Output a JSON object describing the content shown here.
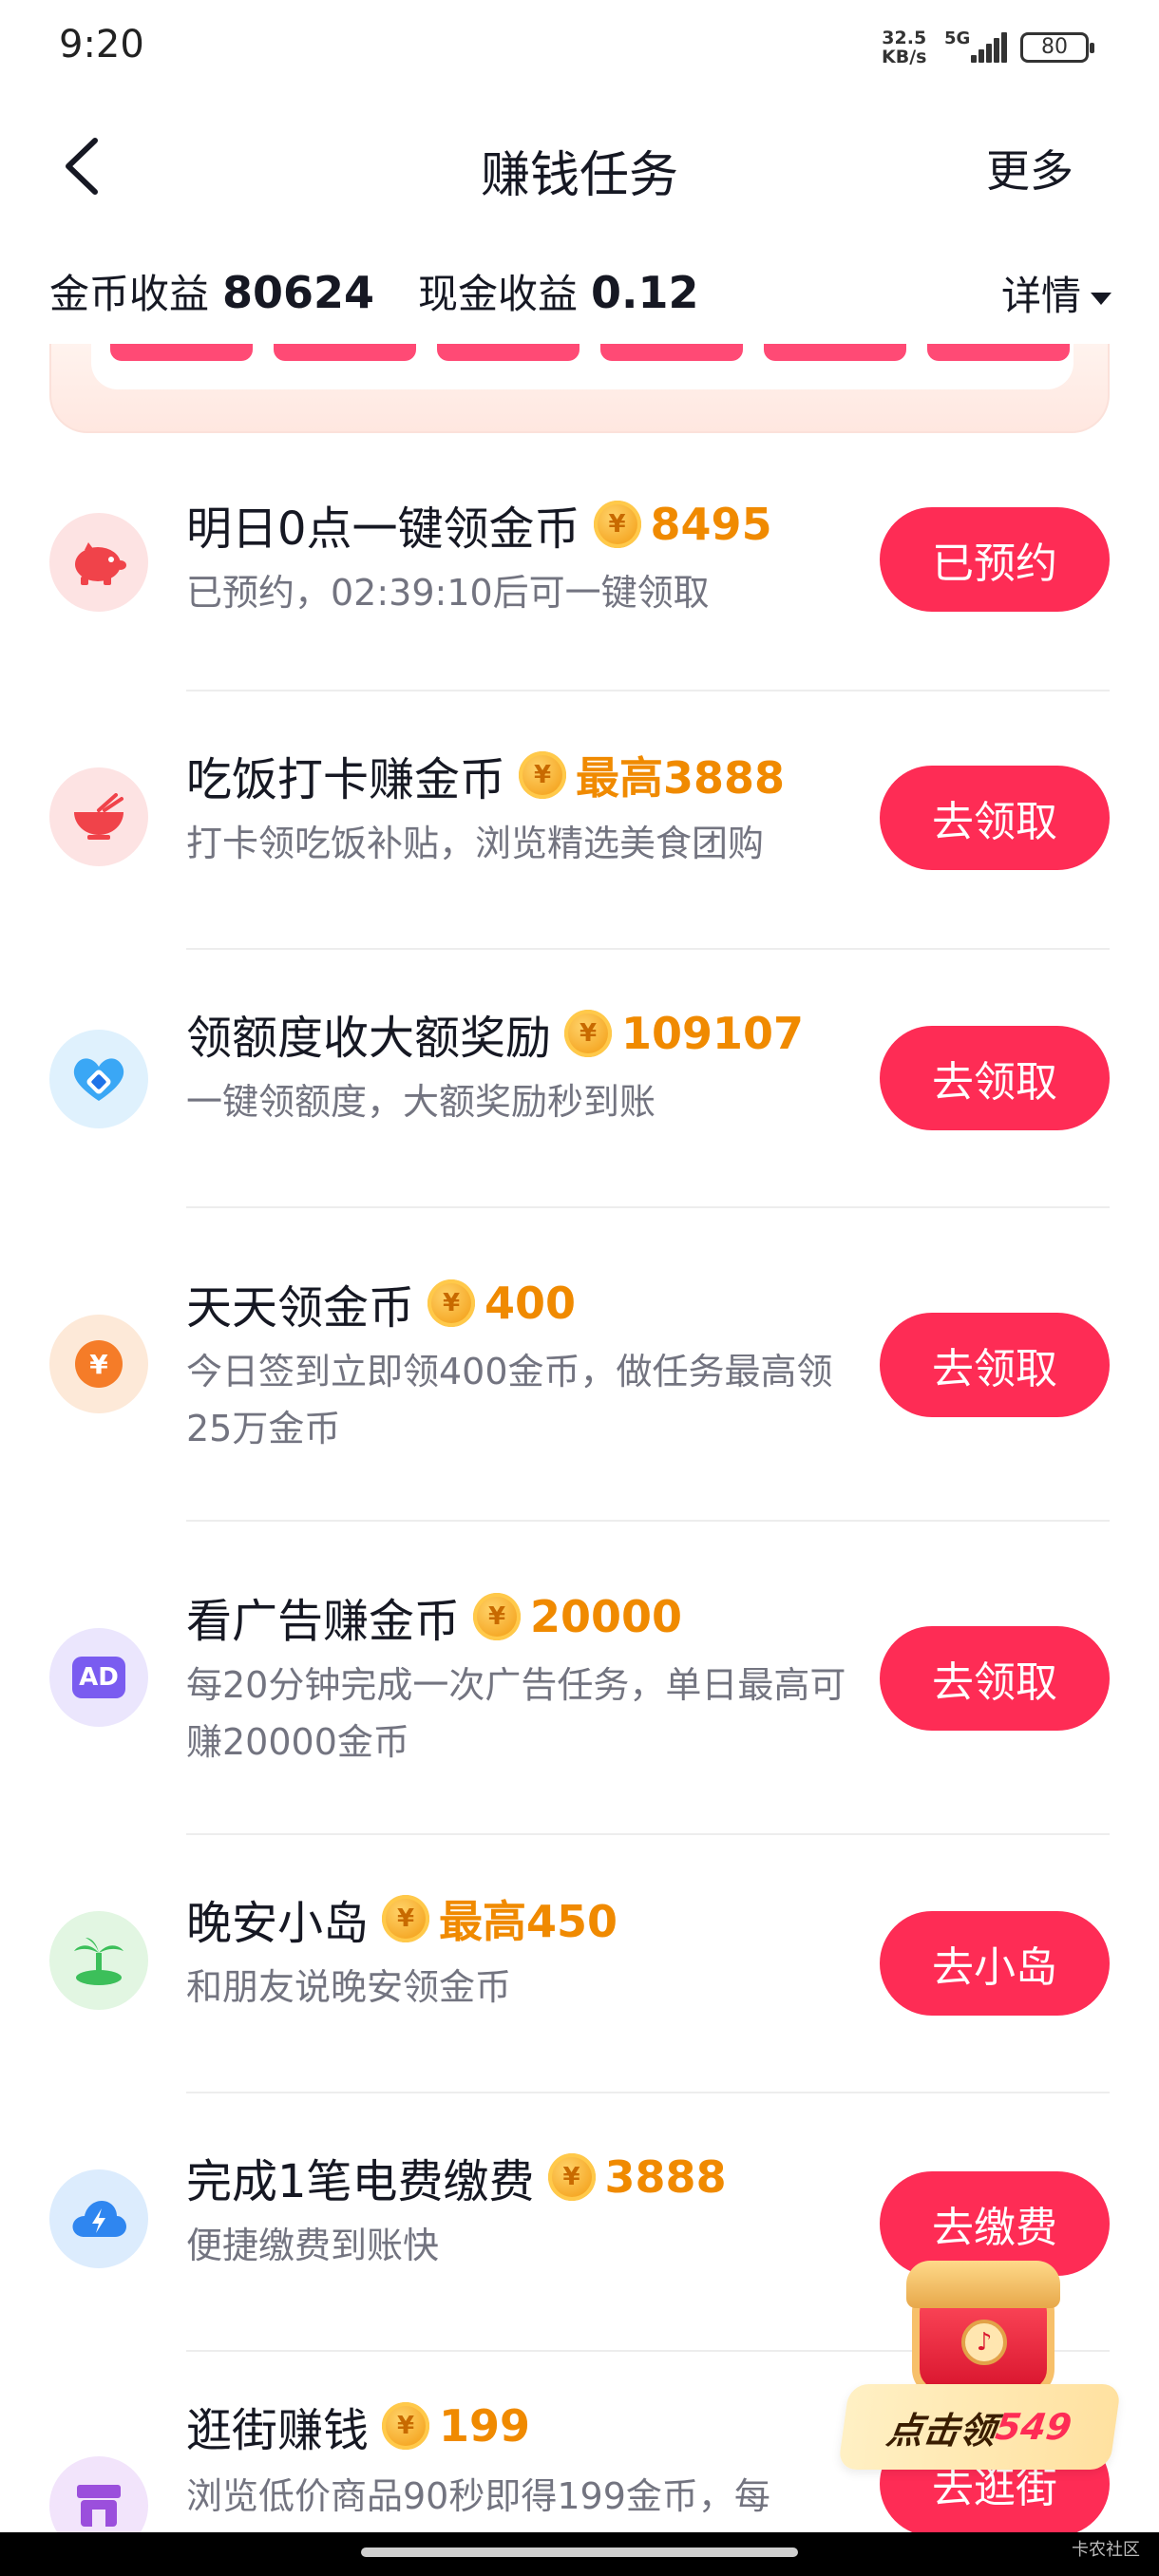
{
  "status_bar": {
    "time": "9:20",
    "net_speed_top": "32.5",
    "net_speed_bottom": "KB/s",
    "net_type": "5G",
    "battery": "80"
  },
  "nav": {
    "title": "赚钱任务",
    "more": "更多"
  },
  "earnings": {
    "gold_label": "金币收益",
    "gold_value": "80624",
    "cash_label": "现金收益",
    "cash_value": "0.12",
    "details": "详情"
  },
  "coin_symbol": "¥",
  "tasks": [
    {
      "title": "明日0点一键领金币",
      "reward": "8495",
      "desc": "已预约，02:39:10后可一键领取",
      "button": "已预约",
      "icon": "piggy-bank-icon"
    },
    {
      "title": "吃饭打卡赚金币",
      "reward": "最高3888",
      "desc": "打卡领吃饭补贴，浏览精选美食团购",
      "button": "去领取",
      "icon": "rice-bowl-icon"
    },
    {
      "title": "领额度收大额奖励",
      "reward": "109107",
      "desc": "一键领额度，大额奖励秒到账",
      "button": "去领取",
      "icon": "credit-heart-icon"
    },
    {
      "title": "天天领金币",
      "reward": "400",
      "desc": "今日签到立即领400金币，做任务最高领25万金币",
      "button": "去领取",
      "icon": "yuan-coin-icon"
    },
    {
      "title": "看广告赚金币",
      "reward": "20000",
      "desc": "每20分钟完成一次广告任务，单日最高可赚20000金币",
      "button": "去领取",
      "icon": "ad-icon",
      "icon_text": "AD"
    },
    {
      "title": "晚安小岛",
      "reward": "最高450",
      "desc": "和朋友说晚安领金币",
      "button": "去小岛",
      "icon": "island-icon"
    },
    {
      "title": "完成1笔电费缴费",
      "reward": "3888",
      "desc": "便捷缴费到账快",
      "button": "去缴费",
      "icon": "electric-cloud-icon"
    },
    {
      "title": "逛街赚钱",
      "reward": "199",
      "desc": "浏览低价商品90秒即得199金币，每",
      "button": "去逛街",
      "icon": "shop-icon"
    }
  ],
  "float_badge": {
    "prefix": "点击领",
    "amount": "549"
  },
  "watermark": "卡农社区",
  "colors": {
    "accent": "#fe2c55",
    "reward": "#f08a00",
    "text_primary": "#161823",
    "text_secondary": "#737480"
  }
}
